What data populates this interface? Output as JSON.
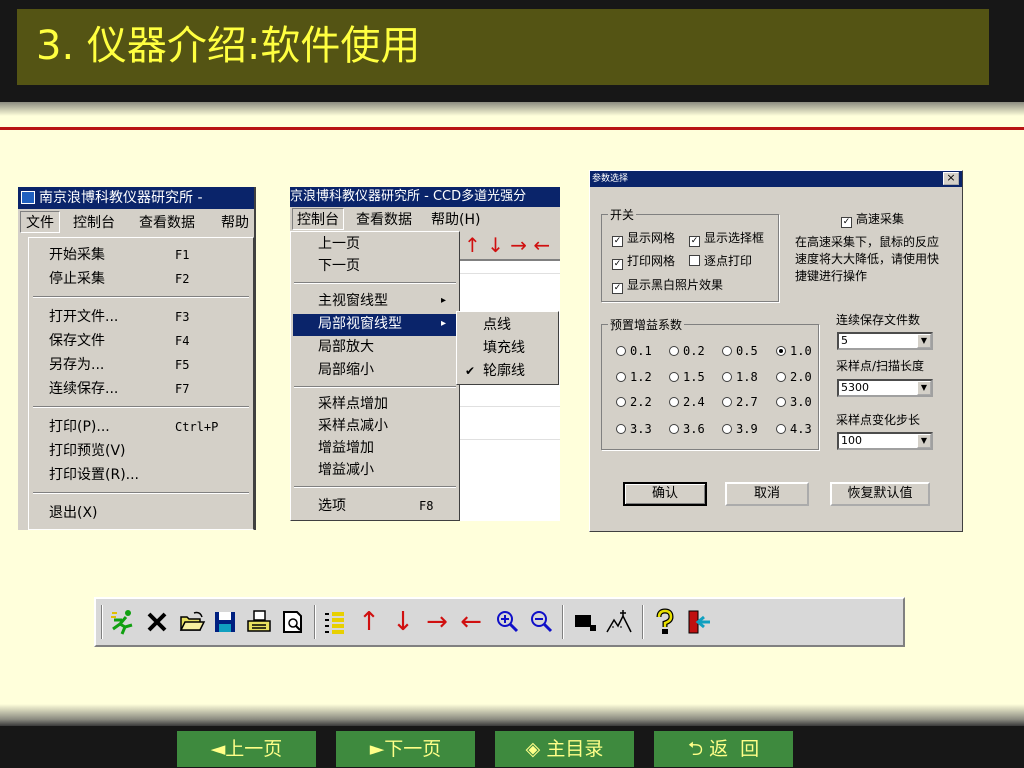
{
  "slide": {
    "title": "3. 仪器介绍:软件使用"
  },
  "shot1": {
    "title": "南京浪博科教仪器研究所 -",
    "menubar": [
      "文件",
      "控制台",
      "查看数据",
      "帮助"
    ],
    "items": [
      {
        "label": "开始采集",
        "accel": "F1"
      },
      {
        "label": "停止采集",
        "accel": "F2"
      },
      {
        "label": "打开文件...",
        "accel": "F3"
      },
      {
        "label": "保存文件",
        "accel": "F4"
      },
      {
        "label": "另存为...",
        "accel": "F5"
      },
      {
        "label": "连续保存...",
        "accel": "F7"
      },
      {
        "label": "打印(P)...",
        "accel": "Ctrl+P"
      },
      {
        "label": "打印预览(V)",
        "accel": ""
      },
      {
        "label": "打印设置(R)...",
        "accel": ""
      },
      {
        "label": "退出(X)",
        "accel": ""
      }
    ]
  },
  "shot2": {
    "title": "京浪博科教仪器研究所 - CCD多道光强分",
    "menubar": [
      "控制台",
      "查看数据",
      "帮助(H)"
    ],
    "items": [
      {
        "label": "上一页",
        "accel": ""
      },
      {
        "label": "下一页",
        "accel": ""
      },
      {
        "label": "主视窗线型",
        "accel": "▸"
      },
      {
        "label": "局部视窗线型",
        "accel": "▸"
      },
      {
        "label": "局部放大",
        "accel": ""
      },
      {
        "label": "局部缩小",
        "accel": ""
      },
      {
        "label": "采样点增加",
        "accel": ""
      },
      {
        "label": "采样点减小",
        "accel": ""
      },
      {
        "label": "增益增加",
        "accel": ""
      },
      {
        "label": "增益减小",
        "accel": ""
      },
      {
        "label": "选项",
        "accel": "F8"
      }
    ],
    "submenu": [
      "点线",
      "填充线",
      "轮廓线"
    ],
    "submenu_checked": "✔",
    "arrows": "↑ ↓ → ←"
  },
  "dialog": {
    "title": "参数选择",
    "close": "×",
    "switch_group": "开关",
    "checks": [
      {
        "label": "显示网格",
        "checked": true
      },
      {
        "label": "显示选择框",
        "checked": true
      },
      {
        "label": "打印网格",
        "checked": true
      },
      {
        "label": "逐点打印",
        "checked": false
      },
      {
        "label": "显示黑白照片效果",
        "checked": true
      }
    ],
    "highspeed": {
      "label": "高速采集",
      "checked": true
    },
    "note": [
      "在高速采集下，鼠标的反应",
      "速度将大大降低，请使用快",
      "捷键进行操作"
    ],
    "gain_group": "预置增益系数",
    "gains": [
      "0.1",
      "0.2",
      "0.5",
      "1.0",
      "1.2",
      "1.5",
      "1.8",
      "2.0",
      "2.2",
      "2.4",
      "2.7",
      "3.0",
      "3.3",
      "3.6",
      "3.9",
      "4.3"
    ],
    "gain_selected": "1.0",
    "save_count_label": "连续保存文件数",
    "save_count": "5",
    "scan_len_label": "采样点/扫描长度",
    "scan_len": "5300",
    "step_label": "采样点变化步长",
    "step": "100",
    "ok": "确认",
    "cancel": "取消",
    "reset": "恢复默认值"
  },
  "toolbar": {
    "icons": [
      "run-icon",
      "stop-icon",
      "open-folder-icon",
      "save-disk-icon",
      "print-icon",
      "print-preview-icon",
      "list-icon",
      "arrow-up-icon",
      "arrow-down-icon",
      "arrow-right-icon",
      "arrow-left-icon",
      "zoom-in-icon",
      "zoom-out-icon",
      "black-white-icon",
      "peak-icon",
      "help-icon",
      "exit-icon"
    ],
    "colors": {
      "red": "#d01010",
      "blue": "#1010c8",
      "green": "#10a010",
      "navy": "#002080"
    }
  },
  "nav": {
    "prev": "◄上一页",
    "next": "►下一页",
    "home": "◈ 主目录",
    "back": "⮌ 返  回"
  },
  "colors": {
    "background": "#ffffdb",
    "title_bar": "#545414",
    "title_text": "#ffff40",
    "accent_line": "#b81414",
    "nav_button": "#3e8a3e",
    "nav_text": "#ffff88",
    "selection": "#0a246a"
  }
}
